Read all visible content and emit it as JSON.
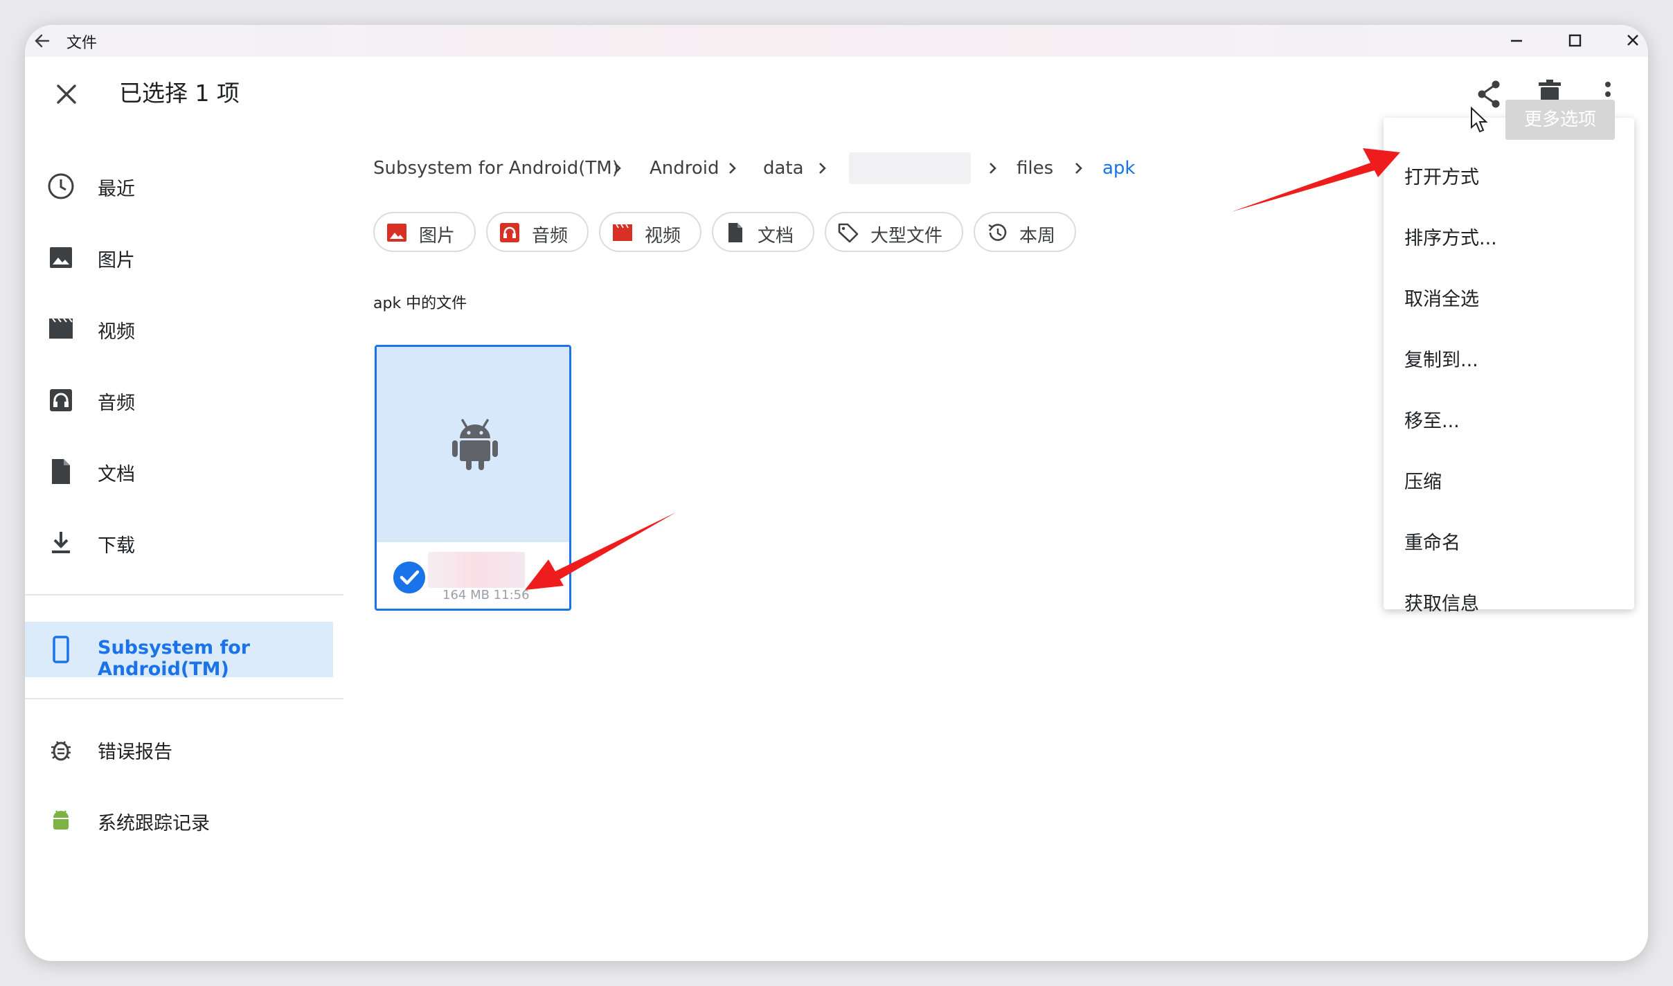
{
  "window": {
    "title": "文件"
  },
  "appbar": {
    "selection_title": "已选择 1 项"
  },
  "sidebar": {
    "items": [
      {
        "label": "最近",
        "icon": "clock-icon"
      },
      {
        "label": "图片",
        "icon": "image-icon"
      },
      {
        "label": "视频",
        "icon": "video-icon"
      },
      {
        "label": "音频",
        "icon": "headphones-icon"
      },
      {
        "label": "文档",
        "icon": "document-icon"
      },
      {
        "label": "下载",
        "icon": "download-icon"
      }
    ],
    "device": {
      "label": "Subsystem for Android(TM)",
      "icon": "phone-icon"
    },
    "extras": [
      {
        "label": "错误报告",
        "icon": "bug-icon"
      },
      {
        "label": "系统跟踪记录",
        "icon": "android-icon"
      }
    ]
  },
  "breadcrumb": [
    "Subsystem for Android(TM)",
    "Android",
    "data",
    "files",
    "apk"
  ],
  "chips": [
    {
      "label": "图片",
      "icon": "image-icon"
    },
    {
      "label": "音频",
      "icon": "headphones-icon"
    },
    {
      "label": "视频",
      "icon": "video-icon"
    },
    {
      "label": "文档",
      "icon": "document-icon"
    },
    {
      "label": "大型文件",
      "icon": "tag-icon"
    },
    {
      "label": "本周",
      "icon": "history-icon"
    }
  ],
  "section": {
    "label": "apk 中的文件"
  },
  "file": {
    "selected": true,
    "meta": "164 MB 11:56"
  },
  "menu": {
    "items": [
      "打开方式",
      "排序方式...",
      "取消全选",
      "复制到...",
      "移至...",
      "压缩",
      "重命名",
      "获取信息"
    ],
    "tooltip": "更多选项"
  },
  "colors": {
    "accent": "#1a73e8",
    "chip_icon": "#d93025",
    "selected_bg": "#dcebfa",
    "annotation": "#ee1c1c"
  }
}
